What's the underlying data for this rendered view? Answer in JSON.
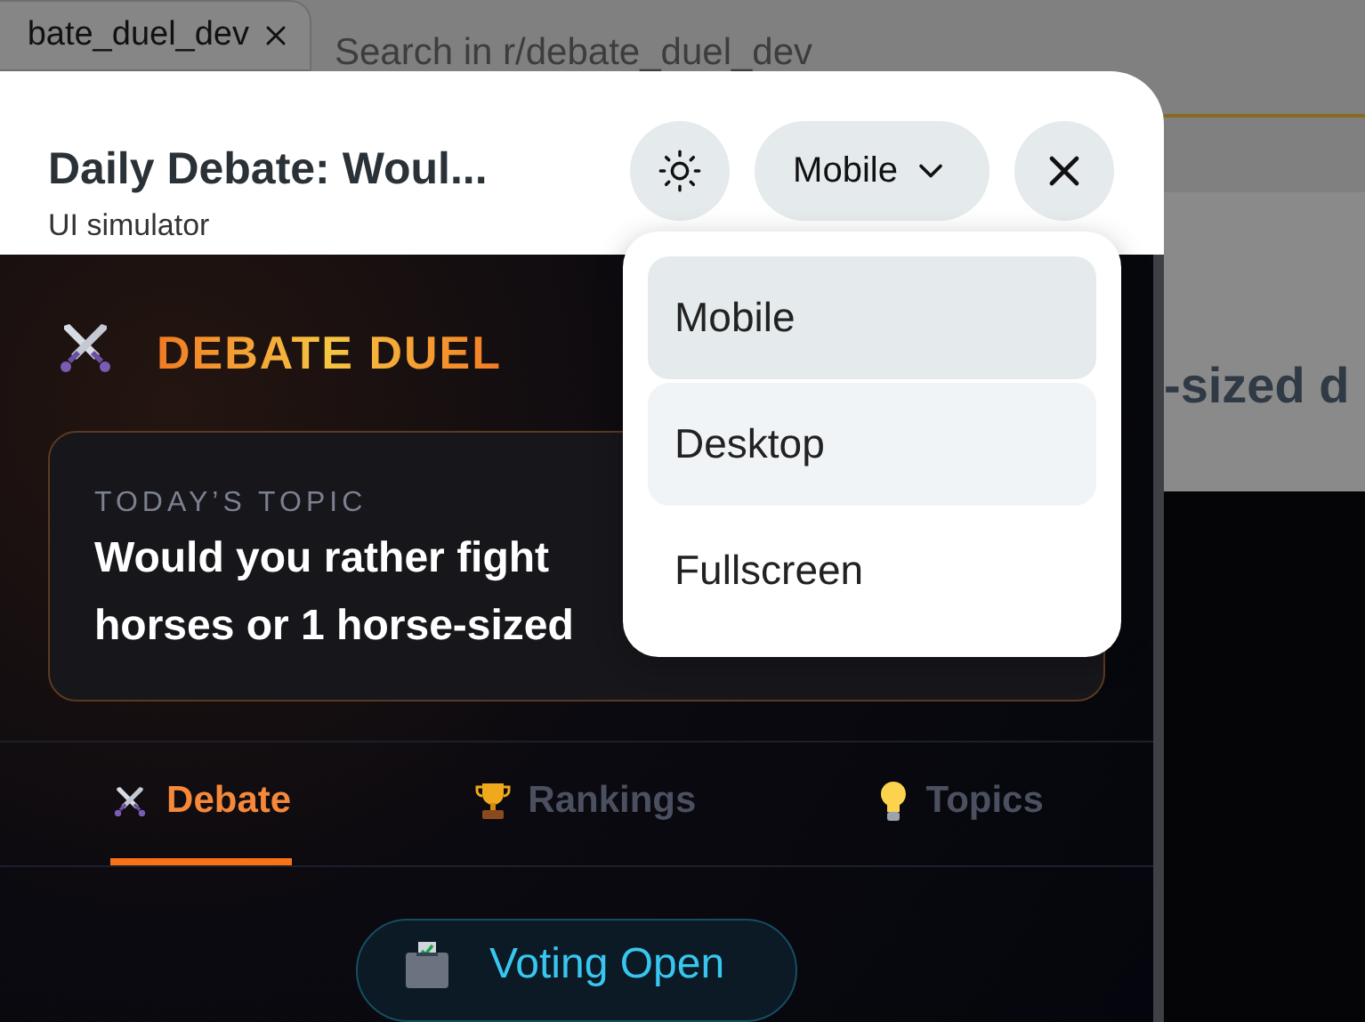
{
  "browser": {
    "tab": {
      "label": "bate_duel_dev"
    },
    "search": {
      "placeholder": "Search in r/debate_duel_dev"
    },
    "background_text": "-sized d"
  },
  "modal": {
    "title": "Daily Debate: Woul...",
    "subtitle": "UI simulator",
    "view_menu": {
      "label": "Mobile",
      "expanded": true,
      "options": [
        {
          "label": "Mobile",
          "selected": true,
          "hovered": false
        },
        {
          "label": "Desktop",
          "selected": false,
          "hovered": true
        },
        {
          "label": "Fullscreen",
          "selected": false,
          "hovered": false
        }
      ]
    }
  },
  "app": {
    "brand": "DEBATE DUEL",
    "topic": {
      "label": "TODAY’S TOPIC",
      "lines": [
        "Would you rather fight",
        "horses or 1 horse-sized"
      ]
    },
    "tabs": [
      {
        "label": "Debate",
        "selected": true
      },
      {
        "label": "Rankings",
        "selected": false
      },
      {
        "label": "Topics",
        "selected": false
      }
    ],
    "status": "Voting Open"
  }
}
